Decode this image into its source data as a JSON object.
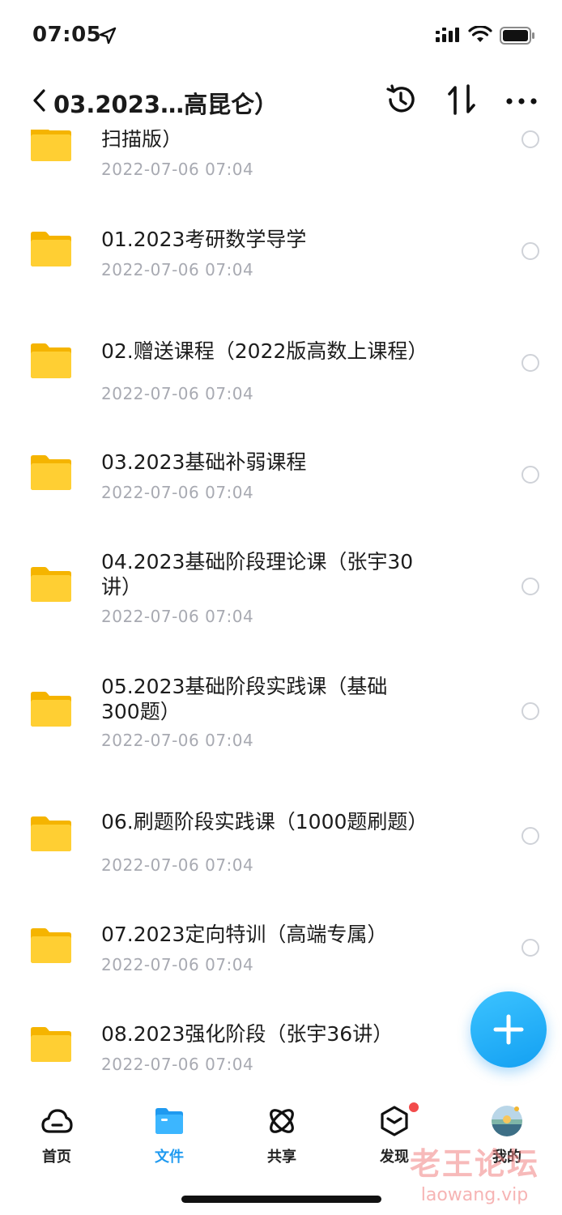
{
  "status_bar": {
    "time": "07:05"
  },
  "nav": {
    "title": "03.2023…高昆仑）"
  },
  "files": [
    {
      "name": "扫描版）",
      "date": "2022-07-06 07:04"
    },
    {
      "name": "01.2023考研数学导学",
      "date": "2022-07-06 07:04"
    },
    {
      "name": "02.赠送课程（2022版高数上课程）",
      "date": "2022-07-06 07:04"
    },
    {
      "name": "03.2023基础补弱课程",
      "date": "2022-07-06 07:04"
    },
    {
      "name": "04.2023基础阶段理论课（张宇30讲）",
      "date": "2022-07-06 07:04"
    },
    {
      "name": "05.2023基础阶段实践课（基础300题）",
      "date": "2022-07-06 07:04"
    },
    {
      "name": "06.刷题阶段实践课（1000题刷题）",
      "date": "2022-07-06 07:04"
    },
    {
      "name": "07.2023定向特训（高端专属）",
      "date": "2022-07-06 07:04"
    },
    {
      "name": "08.2023强化阶段（张宇36讲）",
      "date": "2022-07-06 07:04"
    }
  ],
  "tabs": [
    {
      "label": "首页",
      "icon": "cloud-icon"
    },
    {
      "label": "文件",
      "icon": "folder-icon"
    },
    {
      "label": "共享",
      "icon": "share-orbit-icon"
    },
    {
      "label": "发现",
      "icon": "cube-icon"
    },
    {
      "label": "我的",
      "icon": "avatar-icon"
    }
  ],
  "watermark": {
    "cn": "老王论坛",
    "en": "laowang.vip"
  },
  "colors": {
    "accent": "#1f9af0",
    "folder": "#ffc928",
    "badge": "#f24b4b"
  }
}
